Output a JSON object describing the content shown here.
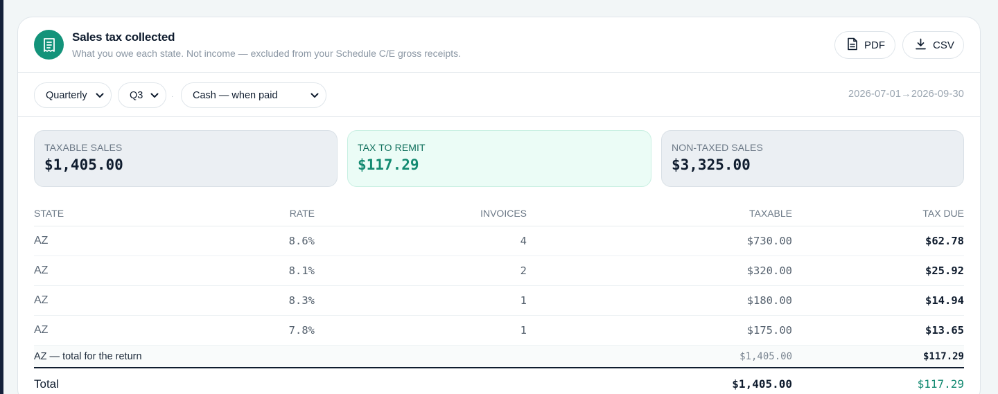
{
  "header": {
    "title": "Sales tax collected",
    "subtitle": "What you owe each state. Not income — excluded from your Schedule C/E gross receipts.",
    "icon": "receipt-icon",
    "accent": "#13937a"
  },
  "actions": {
    "pdf_label": "PDF",
    "csv_label": "CSV"
  },
  "filters": {
    "period": "Quarterly",
    "quarter": "Q3",
    "basis": "Cash — when paid",
    "separator": "·",
    "date_range": "2026-07-01→2026-09-30"
  },
  "summary": {
    "taxable_label": "TAXABLE SALES",
    "taxable_value": "$1,405.00",
    "remit_label": "TAX TO REMIT",
    "remit_value": "$117.29",
    "nontaxed_label": "NON-TAXED SALES",
    "nontaxed_value": "$3,325.00"
  },
  "table": {
    "columns": [
      "STATE",
      "RATE",
      "INVOICES",
      "TAXABLE",
      "TAX DUE"
    ],
    "rows": [
      {
        "state": "AZ",
        "rate": "8.6%",
        "invoices": "4",
        "taxable": "$730.00",
        "tax_due": "$62.78"
      },
      {
        "state": "AZ",
        "rate": "8.1%",
        "invoices": "2",
        "taxable": "$320.00",
        "tax_due": "$25.92"
      },
      {
        "state": "AZ",
        "rate": "8.3%",
        "invoices": "1",
        "taxable": "$180.00",
        "tax_due": "$14.94"
      },
      {
        "state": "AZ",
        "rate": "7.8%",
        "invoices": "1",
        "taxable": "$175.00",
        "tax_due": "$13.65"
      }
    ],
    "subtotal": {
      "label": "AZ — total for the return",
      "taxable": "$1,405.00",
      "tax_due": "$117.29"
    },
    "total": {
      "label": "Total",
      "taxable": "$1,405.00",
      "tax_due": "$117.29"
    }
  }
}
